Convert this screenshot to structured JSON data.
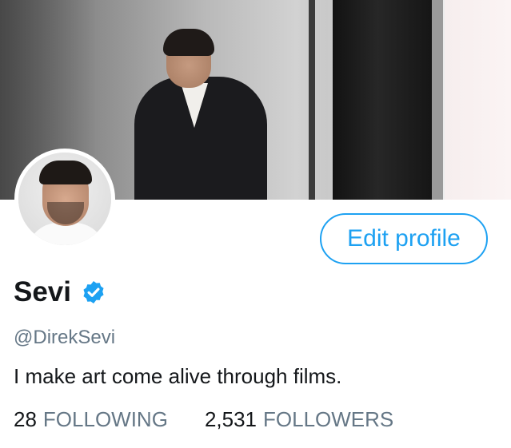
{
  "profile": {
    "name": "Sevi",
    "handle": "@DirekSevi",
    "bio": "I make art come alive through films.",
    "verified": true
  },
  "actions": {
    "edit_profile_label": "Edit profile"
  },
  "stats": {
    "following_count": "28",
    "following_label": "FOLLOWING",
    "followers_count": "2,531",
    "followers_label": "FOLLOWERS"
  },
  "icons": {
    "verified_badge": "verified-badge-icon"
  },
  "colors": {
    "accent": "#1da1f2",
    "secondary_text": "#657786",
    "primary_text": "#14171a"
  }
}
